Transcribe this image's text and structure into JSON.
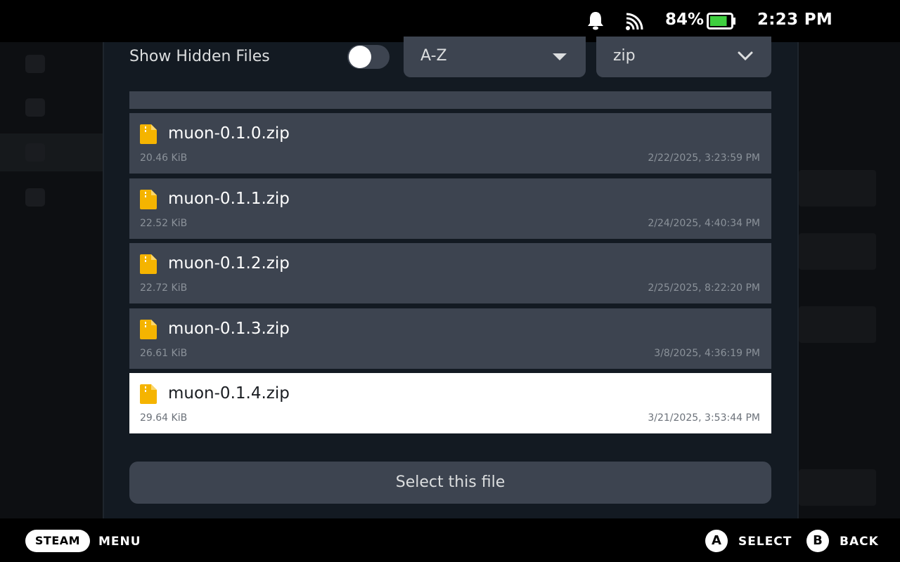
{
  "status_bar": {
    "battery_percent": "84%",
    "time": "2:23 PM",
    "icons": [
      "bell-icon",
      "wifi-icon",
      "battery-icon"
    ],
    "battery_level": 0.84,
    "battery_color": "#3fcf3f"
  },
  "file_picker": {
    "show_hidden_label": "Show Hidden Files",
    "show_hidden_on": false,
    "sort_dropdown": {
      "value": "A-Z"
    },
    "type_dropdown": {
      "value": "zip"
    },
    "files": [
      {
        "name": "muon-0.1.0.zip",
        "size": "20.46 KiB",
        "date": "2/22/2025, 3:23:59 PM",
        "selected": false
      },
      {
        "name": "muon-0.1.1.zip",
        "size": "22.52 KiB",
        "date": "2/24/2025, 4:40:34 PM",
        "selected": false
      },
      {
        "name": "muon-0.1.2.zip",
        "size": "22.72 KiB",
        "date": "2/25/2025, 8:22:20 PM",
        "selected": false
      },
      {
        "name": "muon-0.1.3.zip",
        "size": "26.61 KiB",
        "date": "3/8/2025, 4:36:19 PM",
        "selected": false
      },
      {
        "name": "muon-0.1.4.zip",
        "size": "29.64 KiB",
        "date": "3/21/2025, 3:53:44 PM",
        "selected": true
      }
    ],
    "select_button_label": "Select this file",
    "file_icon_color": "#f5b400"
  },
  "bottom_bar": {
    "steam_label": "STEAM",
    "menu_label": "MENU",
    "a_button": "A",
    "select_label": "SELECT",
    "b_button": "B",
    "back_label": "BACK"
  }
}
